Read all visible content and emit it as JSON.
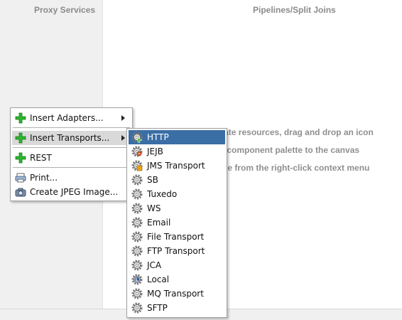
{
  "lanes": {
    "proxy_services": "Proxy Services",
    "pipelines": "Pipelines/Split Joins"
  },
  "hint": {
    "line1": "To create resources, drag and drop an icon",
    "line2": "from the component palette to the canvas",
    "line3": "or select one from the right-click context menu"
  },
  "context_menu": {
    "insert_adapters": "Insert Adapters...",
    "insert_transports": "Insert Transports...",
    "rest": "REST",
    "print": "Print...",
    "create_jpeg": "Create JPEG Image..."
  },
  "transports_menu": {
    "items": [
      {
        "label": "HTTP",
        "icon": "http-gear-icon"
      },
      {
        "label": "JEJB",
        "icon": "jejb-gear-icon"
      },
      {
        "label": "JMS Transport",
        "icon": "jms-gear-icon"
      },
      {
        "label": "SB",
        "icon": "gear-icon"
      },
      {
        "label": "Tuxedo",
        "icon": "gear-icon"
      },
      {
        "label": "WS",
        "icon": "gear-icon"
      },
      {
        "label": "Email",
        "icon": "gear-icon"
      },
      {
        "label": "File Transport",
        "icon": "gear-icon"
      },
      {
        "label": "FTP Transport",
        "icon": "gear-icon"
      },
      {
        "label": "JCA",
        "icon": "gear-icon"
      },
      {
        "label": "Local",
        "icon": "local-gear-icon"
      },
      {
        "label": "MQ Transport",
        "icon": "gear-icon"
      },
      {
        "label": "SFTP",
        "icon": "gear-icon"
      }
    ]
  },
  "colors": {
    "selection": "#3a6ea5",
    "lane_background": "#f0f0f0",
    "plus_green": "#2fb52f"
  }
}
